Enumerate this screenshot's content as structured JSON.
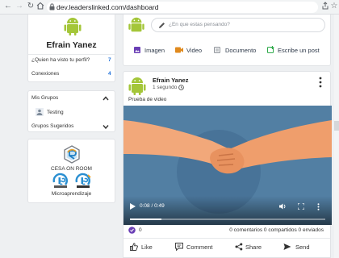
{
  "browser": {
    "url": "dev.leaderslinked.com/dashboard"
  },
  "profile": {
    "name": "Efrain Yanez",
    "stats": [
      {
        "label": "¿Quien ha visto tu perfil?",
        "value": "7"
      },
      {
        "label": "Conexiones",
        "value": "4"
      }
    ]
  },
  "groups": {
    "title": "Mis Grupos",
    "items": [
      {
        "label": "Testing"
      }
    ],
    "suggested_title": "Grupos Sugeridos"
  },
  "promo": {
    "title": "CESA ON ROOM",
    "caption": "Microaprendizaje"
  },
  "composer": {
    "placeholder": "¿En que estas pensando?",
    "actions": [
      {
        "label": "Imagen",
        "color": "#6a3fb5"
      },
      {
        "label": "Video",
        "color": "#e08a1e"
      },
      {
        "label": "Documento",
        "color": "#8a8f96"
      },
      {
        "label": "Escribe un post",
        "color": "#2eaa4a"
      }
    ]
  },
  "post": {
    "author": "Efrain Yanez",
    "time": "1 segundo",
    "text": "Prueba de video",
    "video": {
      "time": "0:08 / 0:49",
      "progress": 0.16
    },
    "reactions_count": "0",
    "stats": "0 comentarios 0 compartidos 0 enviados",
    "actions": [
      "Like",
      "Comment",
      "Share",
      "Send"
    ]
  },
  "colors": {
    "link_blue": "#1e6fd9",
    "video_bg": "#527fa3",
    "android_green": "#a4c639"
  }
}
